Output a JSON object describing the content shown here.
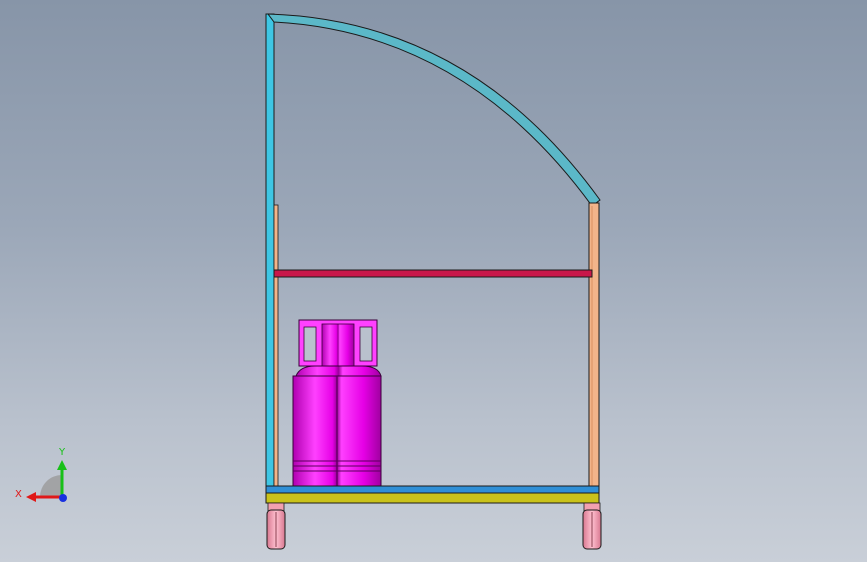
{
  "viewport": {
    "background_top": "#8795a8",
    "background_bottom": "#c9cfd8"
  },
  "model": {
    "frame_left_color": "#3ec6e4",
    "frame_right_color": "#f2b48a",
    "arc_color": "#5bb8c8",
    "crossbar_color": "#c8174a",
    "base_top_color": "#2f8fd6",
    "base_color": "#c9c21a",
    "cylinder_color": "#e600e6",
    "wheel_color": "#f2a0b0"
  },
  "triad": {
    "x_label": "X",
    "y_label": "Y",
    "x_color": "#e01818",
    "y_color": "#18c018",
    "z_color": "#1830e0"
  }
}
